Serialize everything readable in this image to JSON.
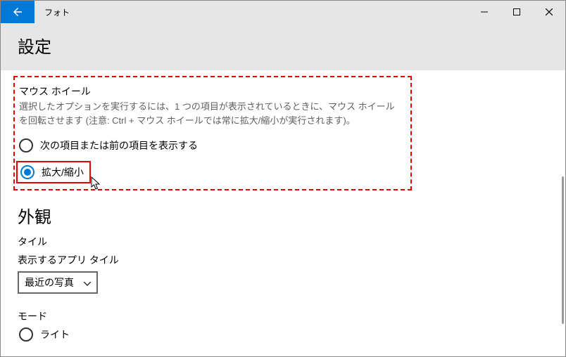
{
  "app": {
    "title": "フォト"
  },
  "header": {
    "title": "設定"
  },
  "mouseWheel": {
    "title": "マウス ホイール",
    "description": "選択したオプションを実行するには、1 つの項目が表示されているときに、マウス ホイールを回転させます (注意: Ctrl + マウス ホイールでは常に拡大/縮小が実行されます)。",
    "options": [
      {
        "label": "次の項目または前の項目を表示する"
      },
      {
        "label": "拡大/縮小"
      }
    ]
  },
  "appearance": {
    "title": "外観",
    "tileLabel": "タイル",
    "appTileLabel": "表示するアプリ タイル",
    "dropdownValue": "最近の写真",
    "modeLabel": "モード",
    "modeOptions": [
      {
        "label": "ライト"
      }
    ]
  }
}
